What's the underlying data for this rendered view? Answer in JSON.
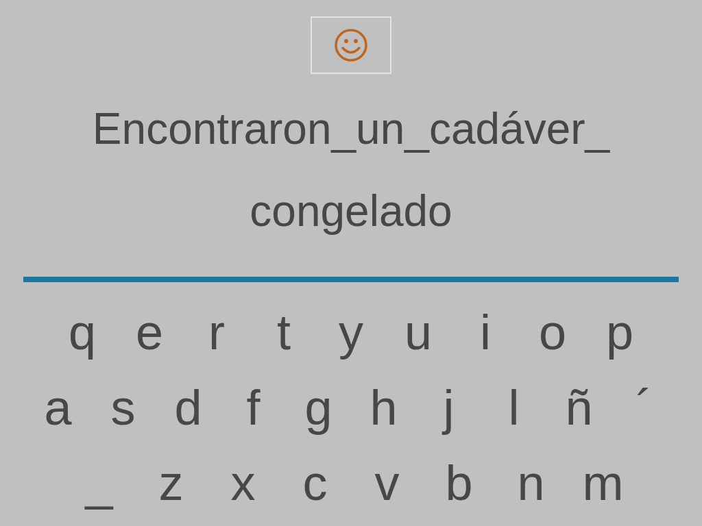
{
  "phrase_lines": [
    "Encontraron_un_cadáver_",
    "congelado"
  ],
  "keyboard": {
    "rows": [
      [
        "q",
        "e",
        "r",
        "t",
        "y",
        "u",
        "i",
        "o",
        "p"
      ],
      [
        "a",
        "s",
        "d",
        "f",
        "g",
        "h",
        "j",
        "l",
        "ñ",
        "´"
      ],
      [
        "_",
        "z",
        "x",
        "c",
        "v",
        "b",
        "n",
        "m"
      ]
    ]
  }
}
